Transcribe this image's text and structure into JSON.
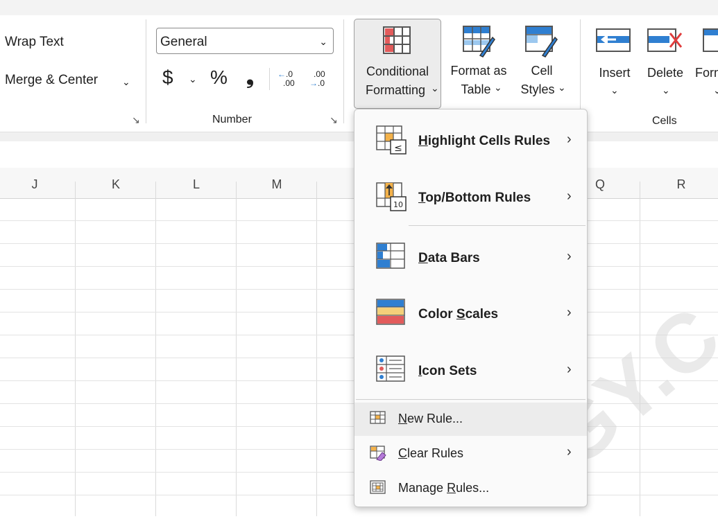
{
  "ribbon": {
    "wrap_text": "Wrap Text",
    "merge_center": "Merge & Center",
    "number_format": "General",
    "currency": "$",
    "percent": "%",
    "comma": "❟",
    "inc_decimal_a": ".0",
    "inc_decimal_b": ".00",
    "dec_decimal_a": ".00",
    "dec_decimal_b": ".0",
    "number_group": "Number",
    "cf_line1": "Conditional",
    "cf_line2": "Formatting",
    "fat_line1": "Format as",
    "fat_line2": "Table",
    "cs_line1": "Cell",
    "cs_line2": "Styles",
    "insert": "Insert",
    "delete": "Delete",
    "format": "Format",
    "cells_group": "Cells"
  },
  "grid": {
    "columns": [
      "J",
      "K",
      "L",
      "M",
      "Q",
      "R"
    ]
  },
  "menu": {
    "highlight_pre": "",
    "highlight_u": "H",
    "highlight_post": "ighlight Cells Rules",
    "topbottom_u": "T",
    "topbottom_post": "op/Bottom Rules",
    "databars_u": "D",
    "databars_post": "ata Bars",
    "colorscales_pre": "Color ",
    "colorscales_u": "S",
    "colorscales_post": "cales",
    "iconsets_u": "I",
    "iconsets_post": "con Sets",
    "newrule_u": "N",
    "newrule_post": "ew Rule...",
    "clearrules_u": "C",
    "clearrules_post": "lear Rules",
    "managerules_pre": "Manage ",
    "managerules_u": "R",
    "managerules_post": "ules..."
  },
  "watermark": "OGY.C",
  "colors": {
    "accent_blue": "#2f7fd1",
    "rule_red": "#e25b5b",
    "rule_orange": "#f4b24a"
  }
}
